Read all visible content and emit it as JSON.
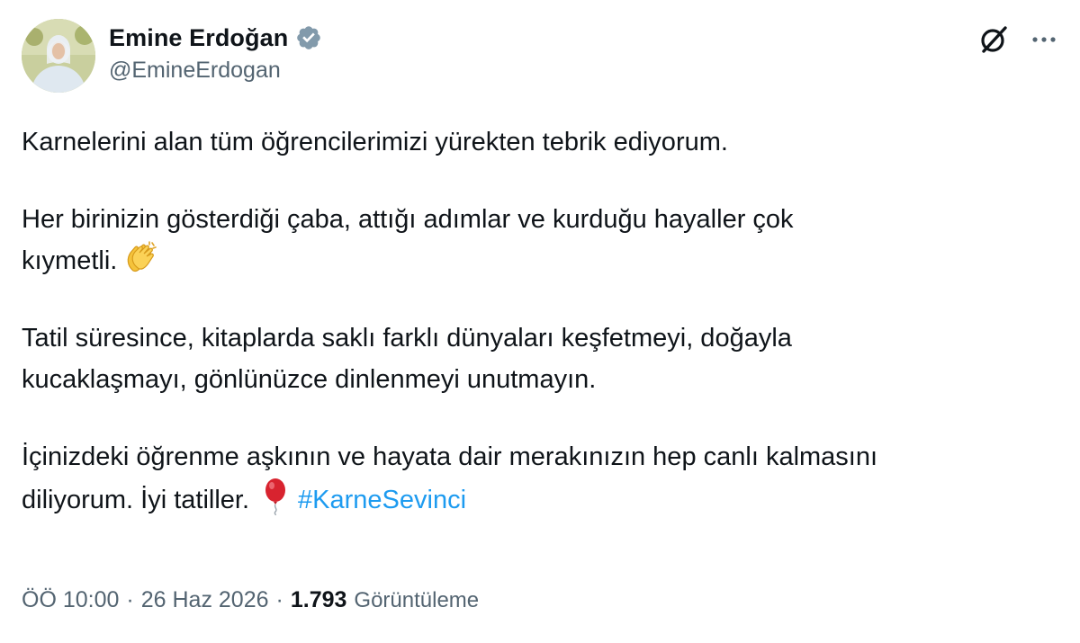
{
  "author": {
    "display_name": "Emine Erdoğan",
    "handle": "@EmineErdogan",
    "verified": true,
    "verified_color": "#829aab"
  },
  "icons": {
    "avatar": "profile-photo",
    "verified": "verified-badge-icon",
    "grok": "grok-icon",
    "more": "more-dots-icon",
    "clap": "clapping-hands-emoji",
    "balloon": "balloon-emoji"
  },
  "tweet": {
    "p1": "Karnelerini alan tüm öğrencilerimizi yürekten tebrik ediyorum.",
    "p2_line1": "Her birinizin gösterdiği çaba, attığı adımlar ve kurduğu hayaller çok",
    "p2_line2": "kıymetli.",
    "p3_line1": "Tatil süresince, kitaplarda saklı farklı dünyaları keşfetmeyi, doğayla",
    "p3_line2": "kucaklaşmayı, gönlünüzce dinlenmeyi unutmayın.",
    "p4_line1": "İçinizdeki öğrenme aşkının ve hayata dair merakınızın hep canlı kalmasını",
    "p4_line2": "diliyorum. İyi tatiller.",
    "hashtag": "#KarneSevinci",
    "hashtag_color": "#1d9bf0"
  },
  "meta": {
    "time": "ÖÖ 10:00",
    "separator": "·",
    "date": "26 Haz 2026",
    "views_count": "1.793",
    "views_label": "Görüntüleme"
  }
}
